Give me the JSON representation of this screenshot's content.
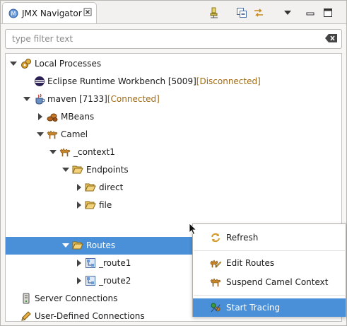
{
  "view": {
    "title": "JMX Navigator",
    "filter_placeholder": "type filter text"
  },
  "tree": [
    {
      "label": "Local Processes",
      "status": "",
      "icon": "local-processes-icon"
    },
    {
      "label": "Eclipse Runtime Workbench [5009]",
      "status": "[Disconnected]",
      "icon": "eclipse-icon"
    },
    {
      "label": "maven [7133]",
      "status": "[Connected]",
      "icon": "java-icon"
    },
    {
      "label": "MBeans",
      "status": "",
      "icon": "beans-icon"
    },
    {
      "label": "Camel",
      "status": "",
      "icon": "camel-icon"
    },
    {
      "label": "_context1",
      "status": "",
      "icon": "camel-icon"
    },
    {
      "label": "Endpoints",
      "status": "",
      "icon": "folder-open-icon"
    },
    {
      "label": "direct",
      "status": "",
      "icon": "folder-icon"
    },
    {
      "label": "file",
      "status": "",
      "icon": "folder-icon"
    },
    {
      "label": "Routes",
      "status": "",
      "icon": "folder-open-icon"
    },
    {
      "label": "_route1",
      "status": "",
      "icon": "route-icon"
    },
    {
      "label": "_route2",
      "status": "",
      "icon": "route-icon"
    },
    {
      "label": "Server Connections",
      "status": "",
      "icon": "server-icon"
    },
    {
      "label": "User-Defined Connections",
      "status": "",
      "icon": "pencil-icon"
    }
  ],
  "context_menu": {
    "items": [
      {
        "label": "Refresh",
        "icon": "refresh-icon"
      },
      {
        "label": "Edit Routes",
        "icon": "edit-routes-icon"
      },
      {
        "label": "Suspend Camel Context",
        "icon": "camel-icon"
      },
      {
        "label": "Start Tracing",
        "icon": "tracing-icon"
      }
    ]
  },
  "colors": {
    "selection": "#4a90d9",
    "status_text": "#a06a14"
  }
}
